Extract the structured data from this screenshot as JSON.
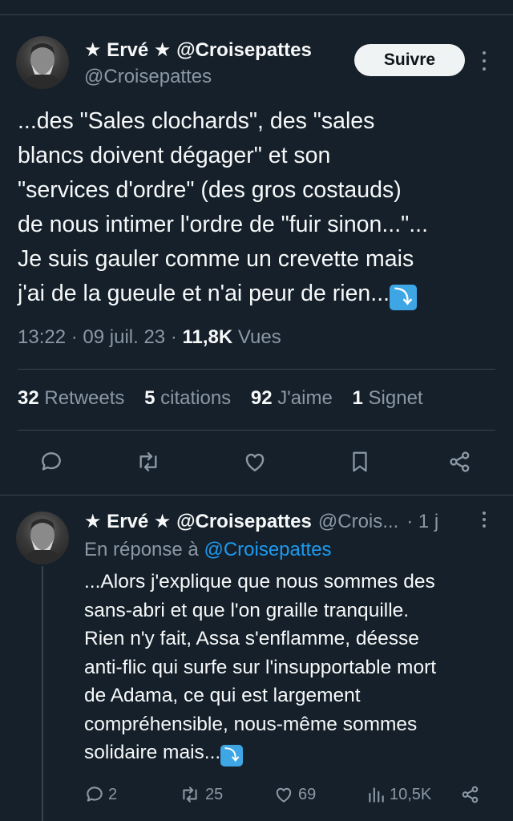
{
  "main_tweet": {
    "author_name": "★ Ervé ★ @Croisepattes",
    "author_handle": "@Croisepattes",
    "follow_label": "Suivre",
    "text_lines": [
      "...des \"Sales clochards\", des \"sales",
      "blancs doivent dégager\" et son",
      "\"services d'ordre\" (des gros costauds)",
      "de nous intimer l'ordre de \"fuir sinon...\"...",
      "Je suis gauler comme un crevette mais",
      "j'ai de la gueule et n'ai peur de rien..."
    ],
    "emoji": "⤵",
    "time": "13:22",
    "date": "09 juil. 23",
    "views_count": "11,8K",
    "views_label": "Vues",
    "retweets_count": "32",
    "retweets_label": "Retweets",
    "quotes_count": "5",
    "quotes_label": "citations",
    "likes_count": "92",
    "likes_label": "J'aime",
    "bookmarks_count": "1",
    "bookmarks_label": "Signet",
    "actions": [
      "reply-icon",
      "retweet-icon",
      "like-icon",
      "bookmark-icon",
      "share-icon"
    ]
  },
  "reply_tweet": {
    "author_name": "★ Ervé ★ @Croisepattes",
    "author_handle_truncated": "@Crois...",
    "age": "· 1 j",
    "replying_to_label": "En réponse à",
    "replying_to_handle": "@Croisepattes",
    "text_lines": [
      "...Alors j'explique que nous sommes des",
      "sans-abri et que l'on graille tranquille.",
      "Rien n'y fait, Assa s'enflamme, déesse",
      "anti-flic qui surfe sur l'insupportable mort",
      "de Adama, ce qui est largement",
      "compréhensible, nous-même sommes",
      "solidaire mais..."
    ],
    "emoji": "⤵",
    "reply_count": "2",
    "retweet_count": "25",
    "like_count": "69",
    "views_count": "10,5K"
  },
  "colors": {
    "background": "#15202b",
    "text": "#f7f9f9",
    "secondary": "#8b98a5",
    "link": "#1d9bf0",
    "divider": "#38444d"
  }
}
